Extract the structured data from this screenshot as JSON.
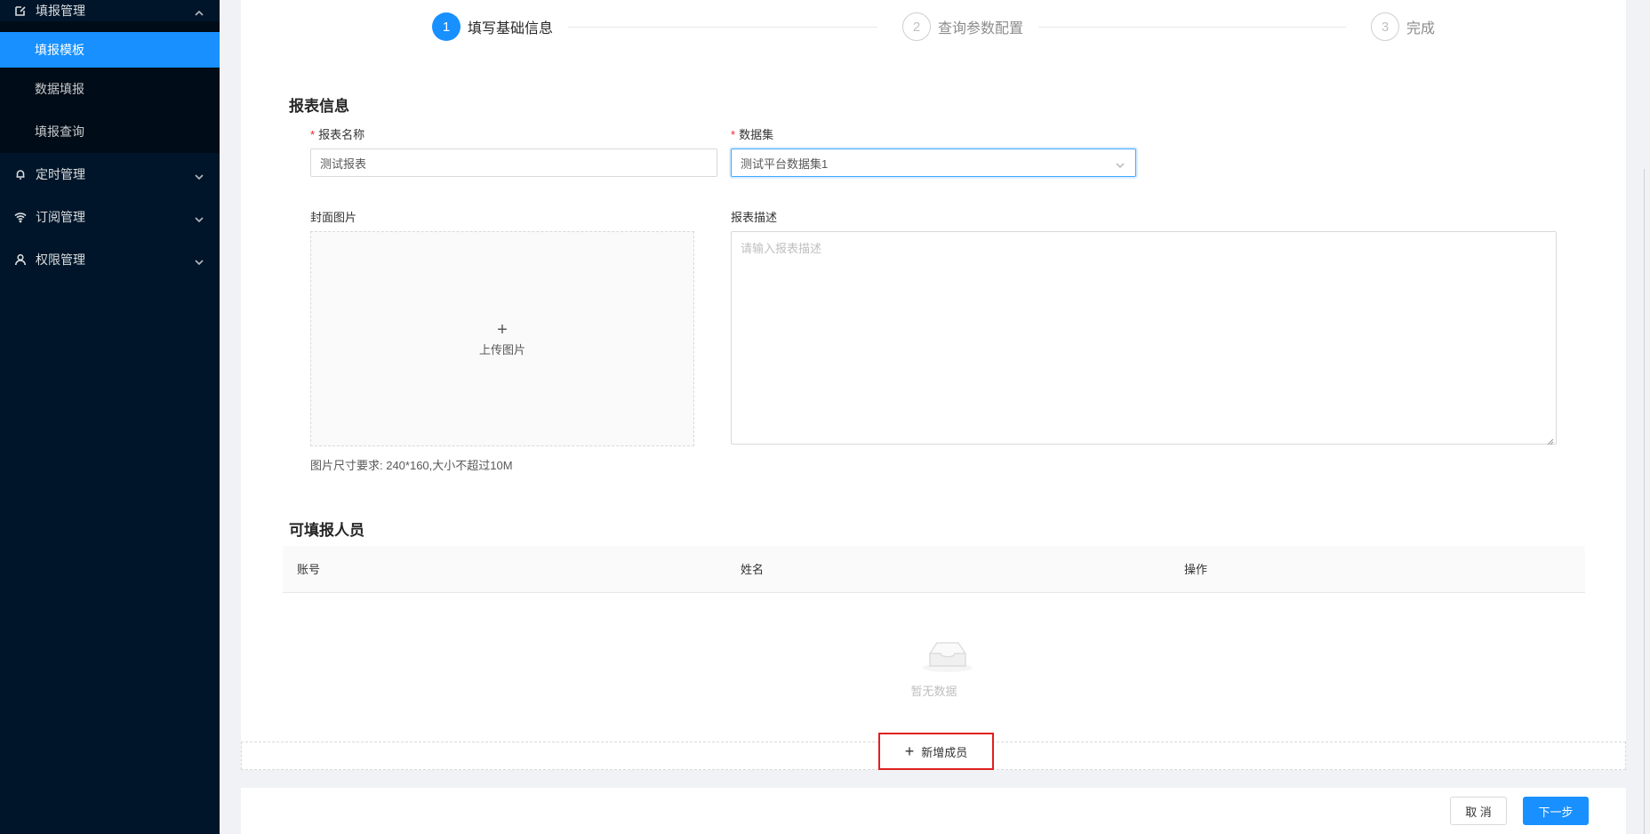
{
  "sidebar": {
    "group_main": {
      "label": "填报管理",
      "icon": "edit-icon",
      "expanded": true
    },
    "sub_items": [
      {
        "label": "填报模板",
        "active": true
      },
      {
        "label": "数据填报",
        "active": false
      },
      {
        "label": "填报查询",
        "active": false
      }
    ],
    "groups": [
      {
        "label": "定时管理",
        "icon": "bell-icon"
      },
      {
        "label": "订阅管理",
        "icon": "wifi-icon"
      },
      {
        "label": "权限管理",
        "icon": "user-icon"
      }
    ]
  },
  "steps": [
    {
      "number": "1",
      "title": "填写基础信息",
      "status": "active"
    },
    {
      "number": "2",
      "title": "查询参数配置",
      "status": "wait"
    },
    {
      "number": "3",
      "title": "完成",
      "status": "wait"
    }
  ],
  "report_info": {
    "section_title": "报表信息",
    "name_label": "报表名称",
    "name_value": "测试报表",
    "dataset_label": "数据集",
    "dataset_value": "测试平台数据集1",
    "cover_label": "封面图片",
    "upload_label": "上传图片",
    "cover_hint": "图片尺寸要求: 240*160,大小不超过10M",
    "desc_label": "报表描述",
    "desc_placeholder": "请输入报表描述"
  },
  "members": {
    "section_title": "可填报人员",
    "columns": [
      "账号",
      "姓名",
      "操作"
    ],
    "empty_text": "暂无数据",
    "add_label": "新增成员"
  },
  "footer": {
    "cancel_label": "取 消",
    "next_label": "下一步"
  },
  "colors": {
    "primary": "#1890ff",
    "sidebar_bg": "#001529",
    "highlight_border": "#e02020"
  }
}
